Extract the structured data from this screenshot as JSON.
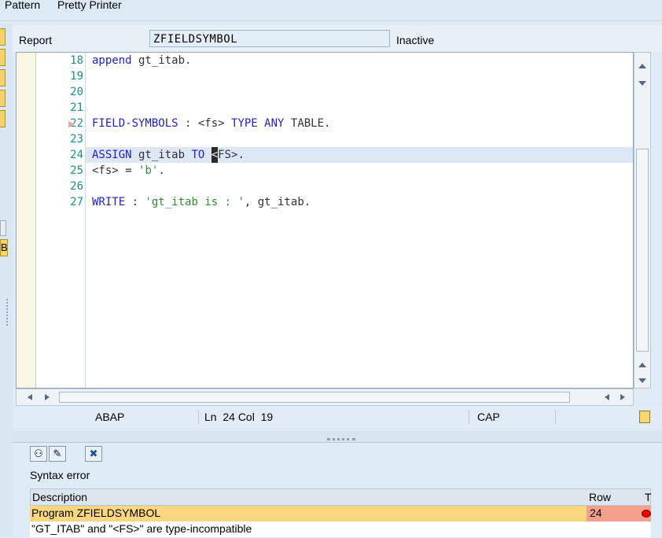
{
  "toolbar": {
    "pattern": "Pattern",
    "pretty_printer": "Pretty Printer"
  },
  "header": {
    "object_type": "Report",
    "program_name": "ZFIELDSYMBOL",
    "status": "Inactive"
  },
  "editor": {
    "lines": [
      {
        "num": "18",
        "code": "append gt_itab."
      },
      {
        "num": "19",
        "code": ""
      },
      {
        "num": "20",
        "code": ""
      },
      {
        "num": "21",
        "code": ""
      },
      {
        "num": "22",
        "code": "FIELD-SYMBOLS : <fs> TYPE ANY TABLE."
      },
      {
        "num": "23",
        "code": ""
      },
      {
        "num": "24",
        "code": "ASSIGN gt_itab TO <FS>."
      },
      {
        "num": "25",
        "code": "<fs> = 'b'."
      },
      {
        "num": "26",
        "code": ""
      },
      {
        "num": "27",
        "code": "WRITE : 'gt_itab is : ', gt_itab."
      }
    ],
    "highlighted_line": "24"
  },
  "statusbar": {
    "language": "ABAP",
    "position": "Ln  24 Col  19",
    "caps": "CAP"
  },
  "messages": {
    "title": "Syntax error",
    "columns": [
      "Description",
      "Row",
      "T"
    ],
    "rows": [
      {
        "description": "Program ZFIELDSYMBOL",
        "row": "24"
      },
      {
        "description": "\"GT_ITAB\" and \"<FS>\" are type-incompatible",
        "row": ""
      }
    ]
  },
  "colors": {
    "error_row": "#fbd77f",
    "error_cell": "#f4a08c",
    "keyword": "#1f1fc8",
    "line_number": "#1a8f85"
  }
}
